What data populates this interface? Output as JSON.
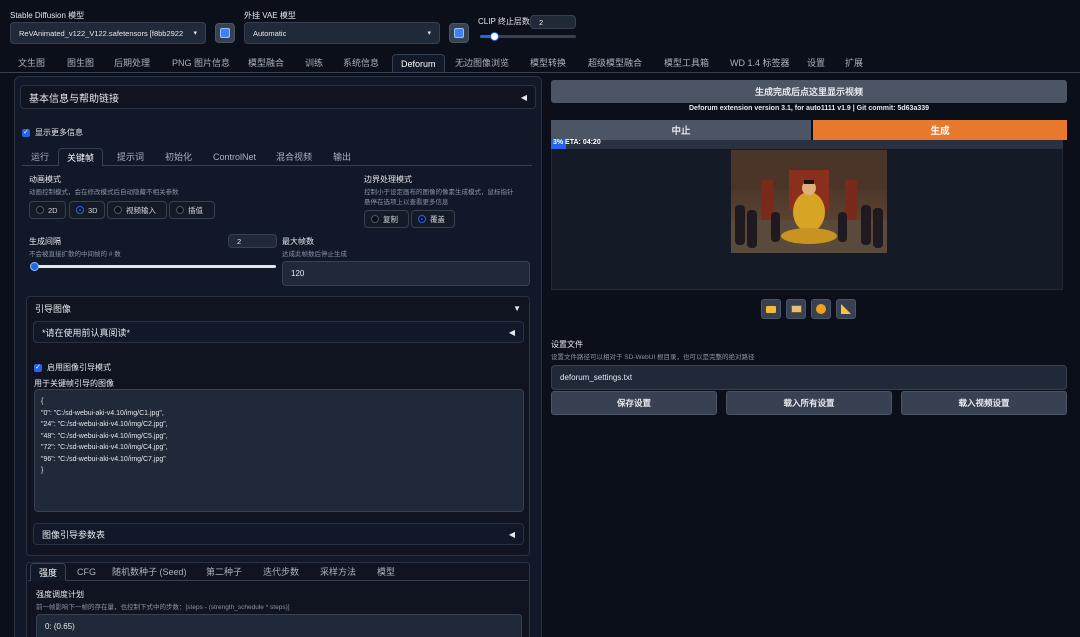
{
  "top": {
    "sd_model_label": "Stable Diffusion 模型",
    "sd_model_value": "ReVAnimated_v122_V122.safetensors [f8bb2922",
    "vae_label": "外挂 VAE 模型",
    "vae_value": "Automatic",
    "clip_label": "CLIP 终止层数",
    "clip_value": "2",
    "clip_slider_fraction": 0.15
  },
  "main_tabs": [
    "文生图",
    "图生图",
    "后期处理",
    "PNG 图片信息",
    "模型融合",
    "训练",
    "系统信息",
    "Deforum",
    "无边图像浏览",
    "模型转换",
    "超级模型融合",
    "模型工具箱",
    "WD 1.4 标签器",
    "设置",
    "扩展"
  ],
  "left": {
    "info_header": "基本信息与帮助链接",
    "show_more_info": "显示更多信息",
    "sub_tabs": [
      "运行",
      "关键帧",
      "提示词",
      "初始化",
      "ControlNet",
      "混合视频",
      "输出"
    ],
    "anim_mode_label": "动画模式",
    "anim_mode_desc": "动画控制模式，会在修改模式后自动隐藏不相关参数",
    "anim_mode_options": [
      "2D",
      "3D",
      "视频输入",
      "插值"
    ],
    "border_label": "边界处理模式",
    "border_desc_1": "控制小于设定画布的图像的像素生成模式，鼠标指针",
    "border_desc_2": "悬停在选项上以查看更多信息",
    "border_options": [
      "复制",
      "覆盖"
    ],
    "cadence_label": "生成间隔",
    "cadence_desc": "不会被直接扩散的中间帧的 # 数",
    "cadence_value": "2",
    "cadence_slider_fraction": 0.0,
    "max_frames_label": "最大帧数",
    "max_frames_desc": "达成此帧数后停止生成",
    "max_frames_value": "120",
    "guided_header": "引导图像",
    "read_before": "*请在使用前认真阅读*",
    "enable_guided": "启用图像引导模式",
    "guided_images_label": "用于关键帧引导的图像",
    "guided_lines": [
      "{",
      "\"0\": \"C:/sd-webui-aki-v4.10/img/C1.jpg\",",
      "\"24\": \"C:/sd-webui-aki-v4.10/img/C2.jpg\",",
      "\"48\": \"C:/sd-webui-aki-v4.10/img/C5.jpg\",",
      "\"72\": \"C:/sd-webui-aki-v4.10/img/C4.jpg\",",
      "\"96\": \"C:/sd-webui-aki-v4.10/img/C7.jpg\"",
      "}"
    ],
    "guided_params_header": "图像引导参数表",
    "bottom_tabs": [
      "强度",
      "CFG",
      "随机数种子 (Seed)",
      "第二种子",
      "迭代步数",
      "采样方法",
      "模型"
    ],
    "strength_label": "强度调度计划",
    "strength_desc": "前一帧影响下一帧的存在量，也控制下式中的步数：[steps - (strength_schedule * steps)]",
    "strength_value": "0: (0.65)"
  },
  "right": {
    "banner": "生成完成后点这里显示视频",
    "version": "Deforum extension version 3.1, for auto1111 v1.9 | Git commit: 5d63a339",
    "interrupt": "中止",
    "generate": "生成",
    "progress_text": "3% ETA: 04:20",
    "progress_fraction": 0.03,
    "settings_file_label": "设置文件",
    "settings_file_desc": "设置文件路径可以相对于 SD-WebUI 根目录，也可以是完整的绝对路径",
    "settings_file_value": "deforum_settings.txt",
    "save_settings": "保存设置",
    "load_all": "载入所有设置",
    "load_video": "载入视频设置",
    "tool_icons": [
      "folder-icon",
      "image-send-icon",
      "palette-icon",
      "ruler-icon"
    ]
  },
  "colors": {
    "accent_orange": "#e8792c",
    "accent_blue": "#2563eb",
    "background": "#0b0f19"
  }
}
